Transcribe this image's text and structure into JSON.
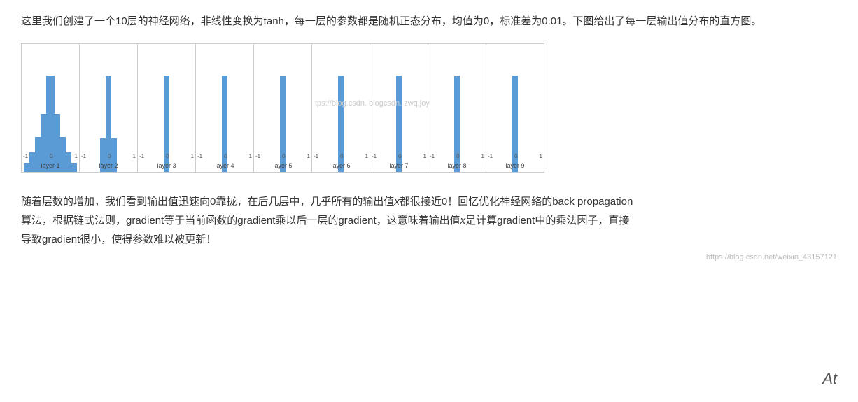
{
  "intro": {
    "text": "这里我们创建了一个10层的神经网络，非线性变换为tanh，每一层的参数都是随机正态分布，均值为0，标准差为0.01。下图给出了每一层输出值分布的直方图。"
  },
  "charts": {
    "layers": [
      {
        "label": "layer 1",
        "type": "wide"
      },
      {
        "label": "layer 2",
        "type": "medium"
      },
      {
        "label": "layer 3",
        "type": "spike"
      },
      {
        "label": "layer 4",
        "type": "spike"
      },
      {
        "label": "layer 5",
        "type": "spike"
      },
      {
        "label": "layer 6",
        "type": "spike"
      },
      {
        "label": "layer 7",
        "type": "spike"
      },
      {
        "label": "layer 8",
        "type": "spike"
      },
      {
        "label": "layer 9",
        "type": "spike"
      }
    ],
    "xLabels": [
      "-1",
      "0",
      "1"
    ],
    "watermark1": "tps://blog.csdn. blogcsdn. zwq.joy",
    "watermark2": ""
  },
  "bottom_text": {
    "paragraph": "随着层数的增加，我们看到输出值迅速向0靠拢，在后几层中，几乎所有的输出值",
    "italic1": "x",
    "part2": "都很接近0！回忆优化神经网络的back propagation算法，根据链式法则，gradient等于当前函数的gradient乘以后一层的gradient，这意味着输出值",
    "italic2": "x",
    "part3": "是计算gradient中的乘法因子，直接导致gradient很小，使得参数难以被更新！",
    "link": "https://blog.csdn.net/weixin_43157121"
  },
  "at_label": "At"
}
